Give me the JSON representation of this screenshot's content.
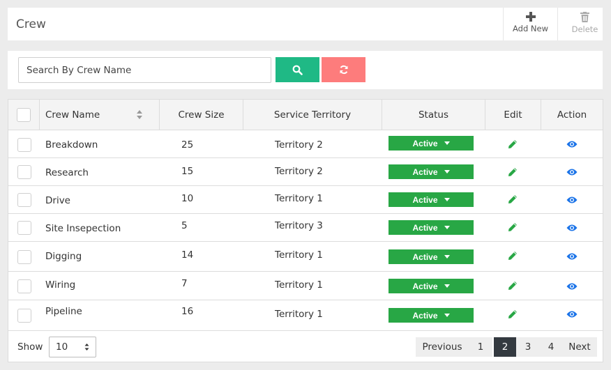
{
  "header": {
    "title": "Crew",
    "add_label": "Add New",
    "delete_label": "Delete"
  },
  "search": {
    "placeholder": "Search By Crew Name",
    "value": ""
  },
  "table": {
    "columns": [
      "Crew Name",
      "Crew Size",
      "Service Territory",
      "Status",
      "Edit",
      "Action"
    ],
    "rows": [
      {
        "name": "Breakdown",
        "size": "25",
        "territory": "Territory 2",
        "status": "Active"
      },
      {
        "name": "Research",
        "size": "15",
        "territory": "Territory 2",
        "status": "Active"
      },
      {
        "name": "Drive",
        "size": "10",
        "territory": "Territory 1",
        "status": "Active"
      },
      {
        "name": "Site Insepection",
        "size": "5",
        "territory": "Territory 3",
        "status": "Active"
      },
      {
        "name": "Digging",
        "size": "14",
        "territory": "Territory 1",
        "status": "Active"
      },
      {
        "name": "Wiring",
        "size": "7",
        "territory": "Territory 1",
        "status": "Active"
      },
      {
        "name": "Pipeline",
        "size": "16",
        "territory": "Territory 1",
        "status": "Active"
      }
    ]
  },
  "footer": {
    "show_label": "Show",
    "page_size": "10",
    "pagination": {
      "previous": "Previous",
      "pages": [
        "1",
        "2",
        "3",
        "4"
      ],
      "current": "2",
      "next": "Next"
    }
  },
  "colors": {
    "search_button": "#1fb985",
    "reset_button": "#fd7c7c",
    "status_active": "#28a745",
    "edit_icon": "#28a745",
    "view_icon": "#1a73e8",
    "active_page": "#343a40"
  }
}
